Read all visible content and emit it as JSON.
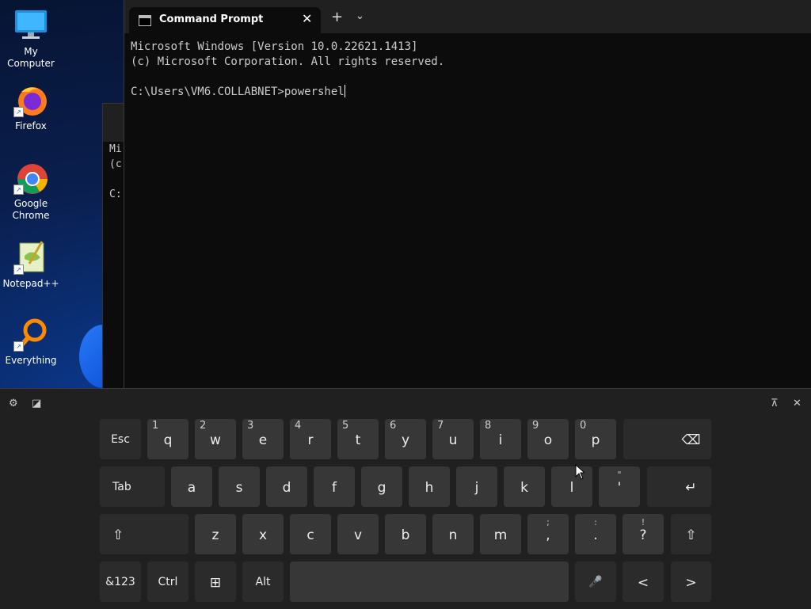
{
  "desktop": {
    "icons": [
      {
        "label": "My Computer"
      },
      {
        "label": "Firefox"
      },
      {
        "label": "Google Chrome"
      },
      {
        "label": "Notepad++"
      },
      {
        "label": "Everything"
      }
    ],
    "background_window": {
      "lines": [
        "Mi",
        "(c",
        "",
        "C:"
      ]
    }
  },
  "terminal": {
    "tab_title": "Command Prompt",
    "new_tab": "+",
    "dropdown": "⌄",
    "close": "✕",
    "lines": [
      "Microsoft Windows [Version 10.0.22621.1413]",
      "(c) Microsoft Corporation. All rights reserved.",
      "",
      "C:\\Users\\VM6.COLLABNET>powershel"
    ]
  },
  "keyboard": {
    "row1": [
      {
        "label": "Esc"
      },
      {
        "label": "q",
        "hint": "1"
      },
      {
        "label": "w",
        "hint": "2"
      },
      {
        "label": "e",
        "hint": "3"
      },
      {
        "label": "r",
        "hint": "4"
      },
      {
        "label": "t",
        "hint": "5"
      },
      {
        "label": "y",
        "hint": "6"
      },
      {
        "label": "u",
        "hint": "7"
      },
      {
        "label": "i",
        "hint": "8"
      },
      {
        "label": "o",
        "hint": "9"
      },
      {
        "label": "p",
        "hint": "0"
      },
      {
        "label": "⌫"
      }
    ],
    "row2": [
      {
        "label": "Tab"
      },
      {
        "label": "a"
      },
      {
        "label": "s"
      },
      {
        "label": "d"
      },
      {
        "label": "f"
      },
      {
        "label": "g"
      },
      {
        "label": "h"
      },
      {
        "label": "j"
      },
      {
        "label": "k"
      },
      {
        "label": "l"
      },
      {
        "label": "'",
        "above": "\""
      },
      {
        "label": "↵"
      }
    ],
    "row3": [
      {
        "label": "⇧"
      },
      {
        "label": "z"
      },
      {
        "label": "x"
      },
      {
        "label": "c"
      },
      {
        "label": "v"
      },
      {
        "label": "b"
      },
      {
        "label": "n"
      },
      {
        "label": "m"
      },
      {
        "label": ",",
        "above": ";"
      },
      {
        "label": ".",
        "above": ":"
      },
      {
        "label": "?",
        "above": "!"
      },
      {
        "label": "⇧"
      }
    ],
    "row4": [
      {
        "label": "&123"
      },
      {
        "label": "Ctrl"
      },
      {
        "label": "⊞"
      },
      {
        "label": "Alt"
      },
      {
        "label": ""
      },
      {
        "label": "🎤"
      },
      {
        "label": "<"
      },
      {
        "label": ">"
      }
    ],
    "toolbar": {
      "settings": "⚙",
      "emoji": "◪",
      "dock": "⊼",
      "close": "✕"
    }
  }
}
